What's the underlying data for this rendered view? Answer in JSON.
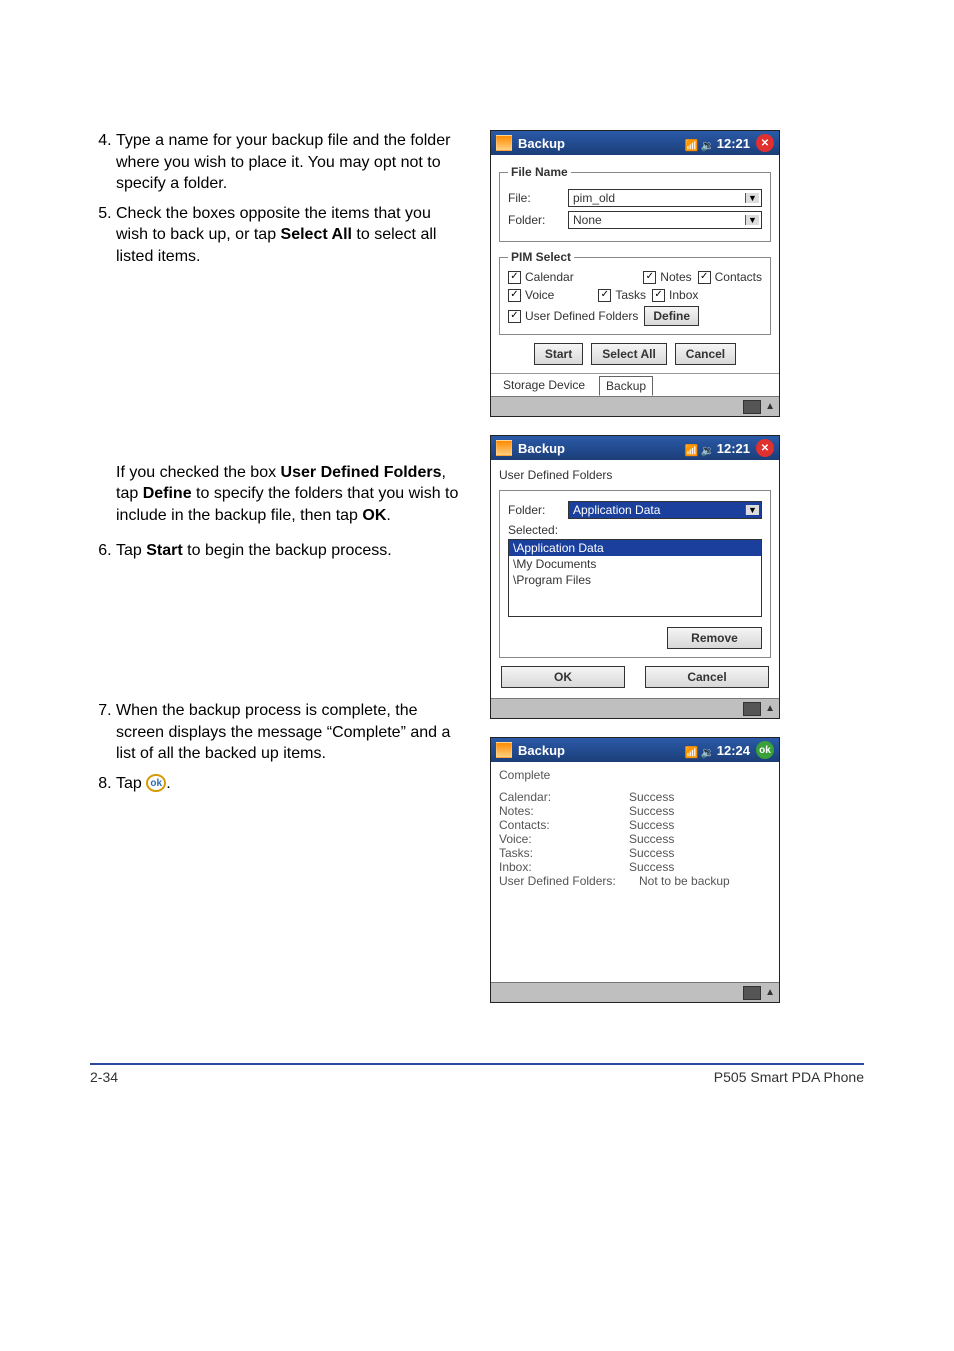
{
  "steps": {
    "s4": "Type a name for your backup file and the folder where you wish to place it. You may opt not to specify a folder.",
    "s5_a": "Check the boxes opposite the items that you wish to back up, or tap ",
    "s5_b": "Select All",
    "s5_c": " to select all listed items.",
    "s5_note_a": "If you checked the box ",
    "s5_note_b": "User Defined Folders",
    "s5_note_c": ", tap ",
    "s5_note_d": "Define",
    "s5_note_e": " to specify the folders that you wish to include in the backup file, then tap ",
    "s5_note_f": "OK",
    "s5_note_g": ".",
    "s6_a": "Tap ",
    "s6_b": "Start",
    "s6_c": " to begin the backup process.",
    "s7": "When the backup process is complete, the screen displays the message “Complete” and a list of all the backed up items.",
    "s8_a": "Tap ",
    "s8_b": "ok",
    "s8_c": "."
  },
  "shot1": {
    "title": "Backup",
    "time": "12:21",
    "fs_filename": "File Name",
    "file_lbl": "File:",
    "file_val": "pim_old",
    "folder_lbl": "Folder:",
    "folder_val": "None",
    "fs_pim": "PIM Select",
    "chk_calendar": "Calendar",
    "chk_notes": "Notes",
    "chk_contacts": "Contacts",
    "chk_voice": "Voice",
    "chk_tasks": "Tasks",
    "chk_inbox": "Inbox",
    "chk_udf": "User Defined Folders",
    "btn_define": "Define",
    "btn_start": "Start",
    "btn_selectall": "Select All",
    "btn_cancel": "Cancel",
    "tab_storage": "Storage Device",
    "tab_backup": "Backup"
  },
  "shot2": {
    "title": "Backup",
    "time": "12:21",
    "heading": "User Defined Folders",
    "folder_lbl": "Folder:",
    "folder_val": "Application Data",
    "selected_lbl": "Selected:",
    "items": [
      "\\Application Data",
      "\\My Documents",
      "\\Program Files"
    ],
    "btn_remove": "Remove",
    "btn_ok": "OK",
    "btn_cancel": "Cancel"
  },
  "shot3": {
    "title": "Backup",
    "time": "12:24",
    "complete": "Complete",
    "rows": [
      {
        "k": "Calendar:",
        "v": "Success"
      },
      {
        "k": "Notes:",
        "v": "Success"
      },
      {
        "k": "Contacts:",
        "v": "Success"
      },
      {
        "k": "Voice:",
        "v": "Success"
      },
      {
        "k": "Tasks:",
        "v": "Success"
      },
      {
        "k": "Inbox:",
        "v": "Success"
      },
      {
        "k": "User Defined Folders:",
        "v": "Not to be backup"
      }
    ]
  },
  "footer": {
    "left": "2-34",
    "right": "P505 Smart PDA Phone"
  }
}
